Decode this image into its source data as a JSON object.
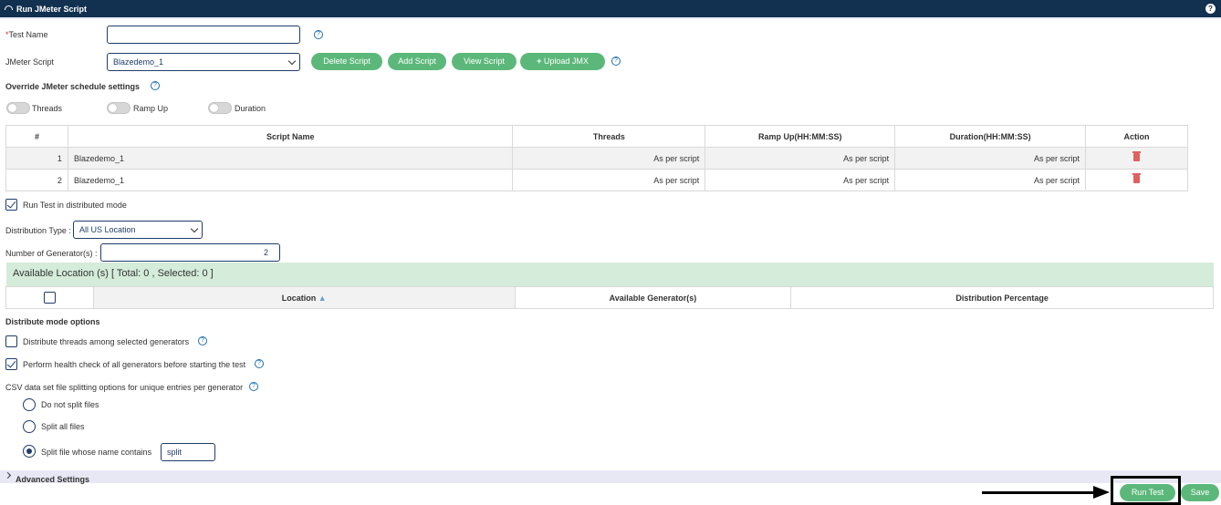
{
  "window": {
    "title": "Run JMeter Script"
  },
  "form": {
    "test_name_label": "Test Name",
    "test_name_required": "*",
    "test_name_value": "",
    "jmeter_script_label": "JMeter Script",
    "jmeter_script_value": "Blazedemo_1",
    "buttons": {
      "delete": "Delete Script",
      "add": "Add Script",
      "view": "View Script",
      "upload": "Upload JMX"
    }
  },
  "override": {
    "heading": "Override JMeter schedule settings",
    "toggles": [
      "Threads",
      "Ramp Up",
      "Duration"
    ]
  },
  "scripts_table": {
    "headers": [
      "#",
      "Script Name",
      "Threads",
      "Ramp Up(HH:MM:SS)",
      "Duration(HH:MM:SS)",
      "Action"
    ],
    "rows": [
      {
        "num": "1",
        "name": "Blazedemo_1",
        "threads": "As per script",
        "ramp": "As per script",
        "duration": "As per script"
      },
      {
        "num": "2",
        "name": "Blazedemo_1",
        "threads": "As per script",
        "ramp": "As per script",
        "duration": "As per script"
      }
    ]
  },
  "distributed": {
    "run_distributed_label": "Run Test in distributed mode",
    "run_distributed_checked": true,
    "distribution_type_label": "Distribution Type :",
    "distribution_type_value": "All US Location",
    "generators_label": "Number of Generator(s) :",
    "generators_value": "2",
    "available_location": "Available Location (s) [ Total: 0 , Selected: 0 ]",
    "location_headers": [
      "Location",
      "Available Generator(s)",
      "Distribution Percentage"
    ]
  },
  "options": {
    "heading": "Distribute mode options",
    "distribute_threads": "Distribute threads among selected generators",
    "distribute_threads_checked": false,
    "health_check": "Perform health check of all generators before starting the test",
    "health_check_checked": true,
    "csv_heading": "CSV data set file splitting options for unique entries per generator",
    "radios": [
      "Do not split files",
      "Split all files",
      "Split file whose name contains"
    ],
    "selected_radio": 2,
    "split_value": "split"
  },
  "advanced": {
    "label": "Advanced Settings"
  },
  "footer": {
    "run_test": "Run Test",
    "save": "Save"
  },
  "icons": {
    "header": "gauge-icon",
    "help": "help-icon",
    "trash": "trash-icon",
    "plus": "plus-icon",
    "sort": "sort-up-icon"
  },
  "colors": {
    "titlebar": "#12304f",
    "button": "#5cb87a",
    "band": "#d4ecd9",
    "delete": "#e06060"
  }
}
